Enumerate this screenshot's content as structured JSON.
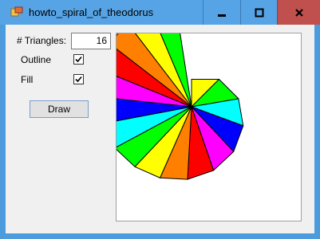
{
  "window": {
    "title": "howto_spiral_of_theodorus"
  },
  "colors": {
    "titlebar": "#56a4e6",
    "close_bg": "#c0504d",
    "palette": [
      "#ff0000",
      "#ff8000",
      "#ffff00",
      "#00ff00",
      "#00ffff",
      "#0000ff",
      "#ff00ff"
    ]
  },
  "controls": {
    "triangles_label": "# Triangles:",
    "triangles_value": "16",
    "outline_label": "Outline",
    "outline_checked": true,
    "fill_label": "Fill",
    "fill_checked": true,
    "draw_label": "Draw"
  },
  "spiral": {
    "triangles": 16
  }
}
